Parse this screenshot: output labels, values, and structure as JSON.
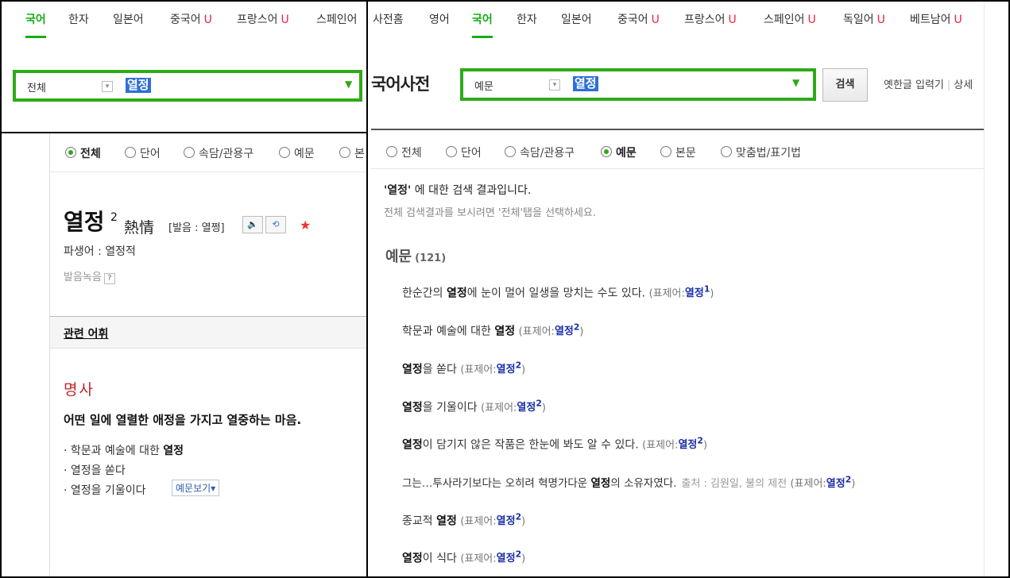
{
  "left": {
    "nav": [
      {
        "label": "국어",
        "active": true,
        "badge": ""
      },
      {
        "label": "한자",
        "active": false,
        "badge": ""
      },
      {
        "label": "일본어",
        "active": false,
        "badge": ""
      },
      {
        "label": "중국어",
        "active": false,
        "badge": "U"
      },
      {
        "label": "프랑스어",
        "active": false,
        "badge": "U"
      },
      {
        "label": "스페인어",
        "active": false,
        "badge": ""
      }
    ],
    "search": {
      "scope": "전체",
      "query": "열정"
    },
    "tabs": [
      {
        "label": "전체",
        "checked": true
      },
      {
        "label": "단어",
        "checked": false
      },
      {
        "label": "속담/관용구",
        "checked": false
      },
      {
        "label": "예문",
        "checked": false
      },
      {
        "label": "본",
        "checked": false
      }
    ],
    "entry": {
      "word": "열정",
      "sup": "2",
      "hanja": "熱情",
      "pronunciation": "[발음 : 열쩡]",
      "derived": "파생어 : 열정적",
      "recording": "발음녹음",
      "help": "?"
    },
    "related_label": "관련 어휘",
    "pos": "명사",
    "definition": "어떤 일에 열렬한 애정을 가지고 열중하는 마음.",
    "examples": [
      {
        "pre": "· 학문과 예술에 대한 ",
        "word": "열정",
        "post": ""
      },
      {
        "pre": "· ",
        "word": "열정",
        "post": "을 쏟다"
      },
      {
        "pre": "· ",
        "word": "열정",
        "post": "을 기울이다"
      }
    ],
    "more_button": "예문보기▾"
  },
  "right": {
    "nav": [
      {
        "label": "사전홈",
        "active": false,
        "badge": ""
      },
      {
        "label": "영어",
        "active": false,
        "badge": ""
      },
      {
        "label": "국어",
        "active": true,
        "badge": ""
      },
      {
        "label": "한자",
        "active": false,
        "badge": ""
      },
      {
        "label": "일본어",
        "active": false,
        "badge": ""
      },
      {
        "label": "중국어",
        "active": false,
        "badge": "U"
      },
      {
        "label": "프랑스어",
        "active": false,
        "badge": "U"
      },
      {
        "label": "스페인어",
        "active": false,
        "badge": "U"
      },
      {
        "label": "독일어",
        "active": false,
        "badge": "U"
      },
      {
        "label": "베트남어",
        "active": false,
        "badge": "U"
      }
    ],
    "title": "국어사전",
    "search": {
      "scope": "예문",
      "query": "열정",
      "button": "검색"
    },
    "old_hangul": "옛한글 입력기",
    "detail": "상세",
    "tabs": [
      {
        "label": "전체",
        "checked": false
      },
      {
        "label": "단어",
        "checked": false
      },
      {
        "label": "속담/관용구",
        "checked": false
      },
      {
        "label": "예문",
        "checked": true
      },
      {
        "label": "본문",
        "checked": false
      },
      {
        "label": "맞춤법/표기법",
        "checked": false
      }
    ],
    "summary_word": "'열정'",
    "summary_rest": " 에 대한 검색 결과입니다.",
    "summary_hint": "전체 검색결과를 보시려면 '전체'탭을 선택하세요.",
    "section_title": "예문",
    "section_count": "(121)",
    "ref_label": "(표제어:",
    "ref_close": ")",
    "rows": [
      {
        "pre": "한순간의 ",
        "word": "열정",
        "post": "에 눈이 멀어 일생을 망치는 수도 있다.",
        "source": "",
        "ref_word": "열정",
        "ref_sup": "1"
      },
      {
        "pre": "학문과 예술에 대한 ",
        "word": "열정",
        "post": "",
        "source": "",
        "ref_word": "열정",
        "ref_sup": "2"
      },
      {
        "pre": "",
        "word": "열정",
        "post": "을 쏟다",
        "source": "",
        "ref_word": "열정",
        "ref_sup": "2"
      },
      {
        "pre": "",
        "word": "열정",
        "post": "을 기울이다",
        "source": "",
        "ref_word": "열정",
        "ref_sup": "2"
      },
      {
        "pre": "",
        "word": "열정",
        "post": "이 담기지 않은 작품은 한눈에 봐도 알 수 있다.",
        "source": "",
        "ref_word": "열정",
        "ref_sup": "2"
      },
      {
        "pre": "그는…투사라기보다는 오히려 혁명가다운 ",
        "word": "열정",
        "post": "의 소유자였다.",
        "source": "출처 : 김원일, 불의 제전",
        "ref_word": "열정",
        "ref_sup": "2"
      },
      {
        "pre": "종교적 ",
        "word": "열정",
        "post": "",
        "source": "",
        "ref_word": "열정",
        "ref_sup": "2"
      },
      {
        "pre": "",
        "word": "열정",
        "post": "이 식다",
        "source": "",
        "ref_word": "열정",
        "ref_sup": "2"
      }
    ]
  }
}
